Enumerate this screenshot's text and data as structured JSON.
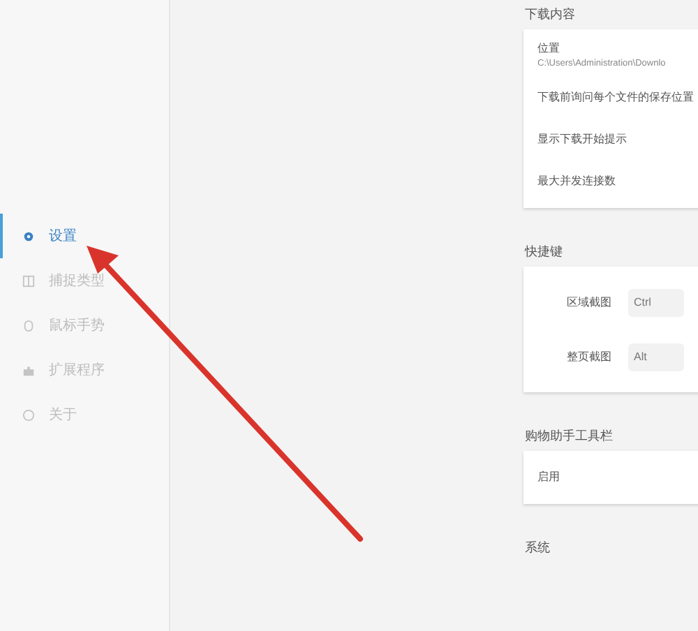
{
  "sidebar": {
    "items": [
      {
        "label": "设置",
        "kind": "gear",
        "selected": true
      },
      {
        "label": "捕捉类型",
        "kind": "grid",
        "selected": false
      },
      {
        "label": "鼠标手势",
        "kind": "mouse",
        "selected": false
      },
      {
        "label": "扩展程序",
        "kind": "puzzle",
        "selected": false
      },
      {
        "label": "关于",
        "kind": "info",
        "selected": false
      }
    ]
  },
  "sections": [
    {
      "title": "下载内容",
      "rows": [
        {
          "label": "位置",
          "value": "C:\\Users\\Administration\\Downlo"
        },
        {
          "label": "下载前询问每个文件的保存位置"
        },
        {
          "label": "显示下载开始提示"
        },
        {
          "label": "最大并发连接数"
        }
      ]
    },
    {
      "title": "快捷键",
      "rows": [
        {
          "label": "区域截图",
          "key": "Ctrl"
        },
        {
          "label": "整页截图",
          "key": "Alt"
        }
      ]
    },
    {
      "title": "购物助手工具栏",
      "rows": [
        {
          "label": "启用"
        }
      ]
    },
    {
      "title": "系统"
    }
  ]
}
